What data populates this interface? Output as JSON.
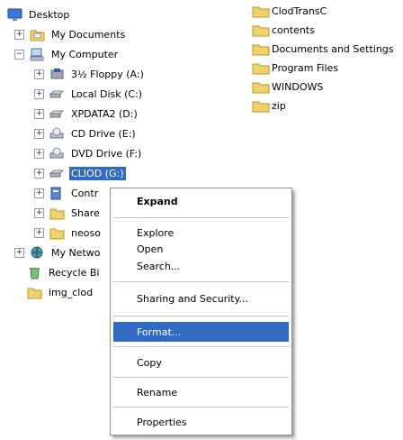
{
  "tree": {
    "desktop": "Desktop",
    "my_documents": "My Documents",
    "my_computer": "My Computer",
    "floppy": "3½ Floppy (A:)",
    "local_disk": "Local Disk (C:)",
    "xpdata2": "XPDATA2 (D:)",
    "cd_drive": "CD Drive (E:)",
    "dvd_drive": "DVD Drive (F:)",
    "clod": "CLIOD (G:)",
    "control_panel": "Contr",
    "shared": "Share",
    "neoso": "neoso",
    "my_network": "My Netwo",
    "recycle_bin": "Recycle Bi",
    "img_clod": "img_clod"
  },
  "files": [
    "ClodTransC",
    "contents",
    "Documents and Settings",
    "Program Files",
    "WINDOWS",
    "zip"
  ],
  "menu": {
    "expand": "Expand",
    "explore": "Explore",
    "open": "Open",
    "search": "Search...",
    "sharing": "Sharing and Security...",
    "format": "Format...",
    "copy": "Copy",
    "rename": "Rename",
    "properties": "Properties"
  },
  "colors": {
    "selection": "#316ac5",
    "folder": "#f0d26b"
  }
}
